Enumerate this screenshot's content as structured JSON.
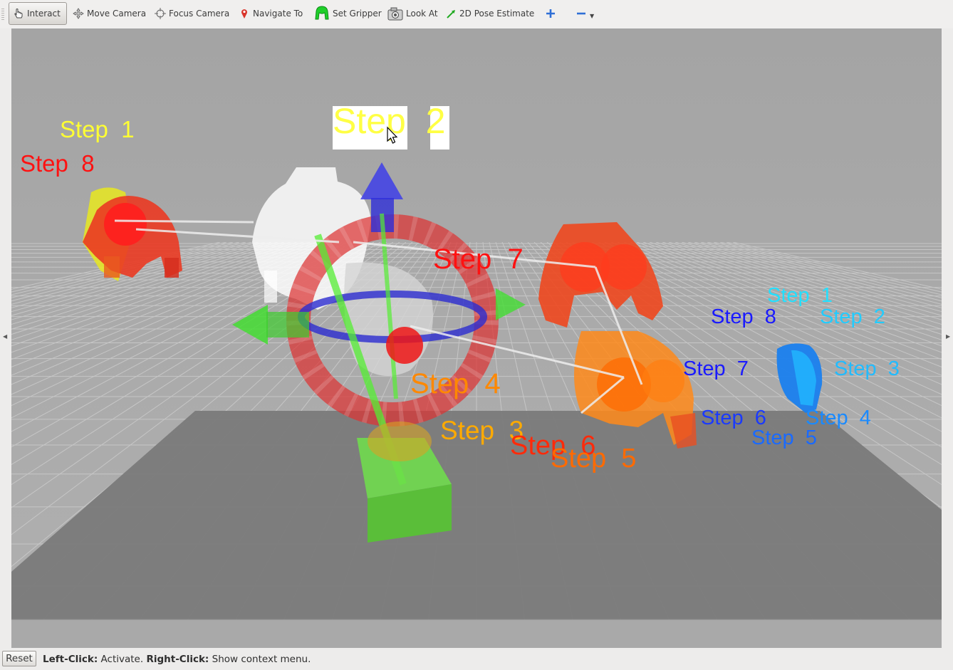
{
  "toolbar": {
    "tools": [
      {
        "label": "Interact",
        "icon": "hand-pointer-icon",
        "active": true
      },
      {
        "label": "Move Camera",
        "icon": "move-camera-icon"
      },
      {
        "label": "Focus Camera",
        "icon": "focus-camera-icon"
      },
      {
        "label": "Navigate To",
        "icon": "map-pin-icon"
      },
      {
        "label": "Set Gripper",
        "icon": "gripper-icon"
      },
      {
        "label": "Look At",
        "icon": "camera-look-at-icon"
      },
      {
        "label": "2D Pose Estimate",
        "icon": "pose-arrow-icon"
      }
    ],
    "add_tool_icon": "plus-icon",
    "remove_tool_icon": "minus-icon"
  },
  "viewport": {
    "labels": {
      "yellow_step1": "Step  1",
      "red_step8": "Step  8",
      "yellow_step2": "Step  2",
      "red_step7": "Step  7",
      "orange_step4": "Step  4",
      "orange_step3": "Step  3",
      "red_step6": "Step  6",
      "orange_step5": "Step  5",
      "cyan_step1": "Step  1",
      "blue_step8": "Step  8",
      "cyan_step2": "Step  2",
      "blue_step7": "Step  7",
      "cyan_step3": "Step  3",
      "blue_step6": "Step  6",
      "blue_step4": "Step  4",
      "blue_step5": "Step  5"
    },
    "colors": {
      "background": "#a6a6a6",
      "grid_line": "#c7c7c7",
      "floor": "#777777",
      "yellow_label": "#ffff33",
      "red_label": "#ff1111",
      "orange_label": "#ff8800",
      "blue_label": "#1a1aff",
      "cyan_label": "#22ccff",
      "gripper_red": "#e8341c",
      "gripper_orange": "#ff7a10",
      "gripper_blue": "#0077ee",
      "marker_green": "#44dd22",
      "marker_blue": "#3333ee",
      "marker_ring": "#dd3333"
    }
  },
  "status": {
    "reset_label": "Reset",
    "left_click_key": "Left-Click:",
    "left_click_action": " Activate. ",
    "right_click_key": "Right-Click:",
    "right_click_action": " Show context menu."
  }
}
